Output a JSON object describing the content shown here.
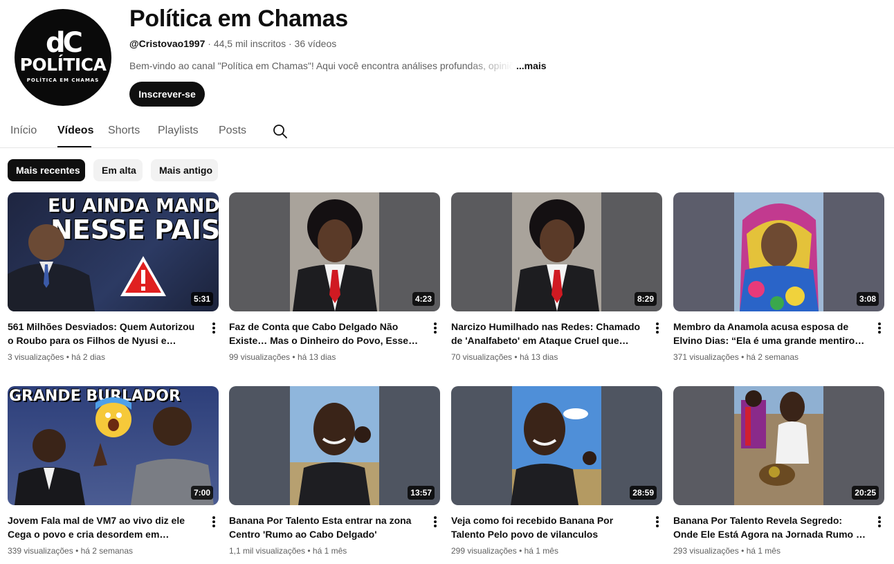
{
  "channel": {
    "avatar_monogram": "dC",
    "avatar_word": "POLÍTICA",
    "avatar_sub": "POLÍTICA EM CHAMAS",
    "title": "Política em Chamas",
    "handle": "@Cristovao1997",
    "subscribers": "44,5 mil inscritos",
    "video_count": "36 vídeos",
    "description": "Bem-vindo ao canal \"Política em Chamas\"! Aqui você encontra análises profundas, opiniões",
    "more_label": "...mais",
    "subscribe_label": "Inscrever-se"
  },
  "tabs": [
    {
      "label": "Início"
    },
    {
      "label": "Vídeos"
    },
    {
      "label": "Shorts"
    },
    {
      "label": "Playlists"
    },
    {
      "label": "Posts"
    }
  ],
  "active_tab": "Vídeos",
  "chips": [
    {
      "label": "Mais recentes"
    },
    {
      "label": "Em alta"
    },
    {
      "label": "Mais antigo"
    }
  ],
  "videos": [
    {
      "title": "561 Milhões Desviados: Quem Autorizou o Roubo para os Filhos de Nyusi e Lucília?",
      "views": "3 visualizações",
      "age": "há 2 dias",
      "duration": "5:31",
      "thumb_text_1": "EU AINDA MANDO",
      "thumb_text_2": "NESSE PAIS"
    },
    {
      "title": "Faz de Conta que Cabo Delgado Não Existe… Mas o Dinheiro do Povo, Esse Sumiço é Real!",
      "views": "99 visualizações",
      "age": "há 13 dias",
      "duration": "4:23"
    },
    {
      "title": "Narcizo Humilhado nas Redes: Chamado de 'Analfabeto' em Ataque Cruel que Choca a Moçambique",
      "views": "70 visualizações",
      "age": "há 13 dias",
      "duration": "8:29"
    },
    {
      "title": "Membro da Anamola acusa esposa de Elvino Dias: “Ela é uma grande mentirosa paga pela Frelimo”",
      "views": "371 visualizações",
      "age": "há 2 semanas",
      "duration": "3:08"
    },
    {
      "title": "Jovem Fala mal de VM7 ao vivo diz ele Cega o povo e cria desordem em Moçambique",
      "views": "339 visualizações",
      "age": "há 2 semanas",
      "duration": "7:00",
      "thumb_text_1": "GRANDE BURLADOR"
    },
    {
      "title": "Banana Por Talento Esta entrar na zona Centro 'Rumo ao Cabo Delgado'",
      "views": "1,1 mil visualizações",
      "age": "há 1 mês",
      "duration": "13:57"
    },
    {
      "title": "Veja como foi recebido Banana Por Talento Pelo povo de vilanculos",
      "views": "299 visualizações",
      "age": "há 1 mês",
      "duration": "28:59"
    },
    {
      "title": "Banana Por Talento Revela Segredo: Onde Ele Está Agora na Jornada Rumo a Cabo Delgado",
      "views": "293 visualizações",
      "age": "há 1 mês",
      "duration": "20:25"
    }
  ],
  "icons": {
    "search": "search-icon",
    "kebab": "more-vert-icon"
  },
  "colors": {
    "text_primary": "#0f0f0f",
    "text_secondary": "#606060",
    "chip_bg": "#f2f2f2",
    "tie_red": "#d01a22",
    "warning_red": "#e02020"
  }
}
